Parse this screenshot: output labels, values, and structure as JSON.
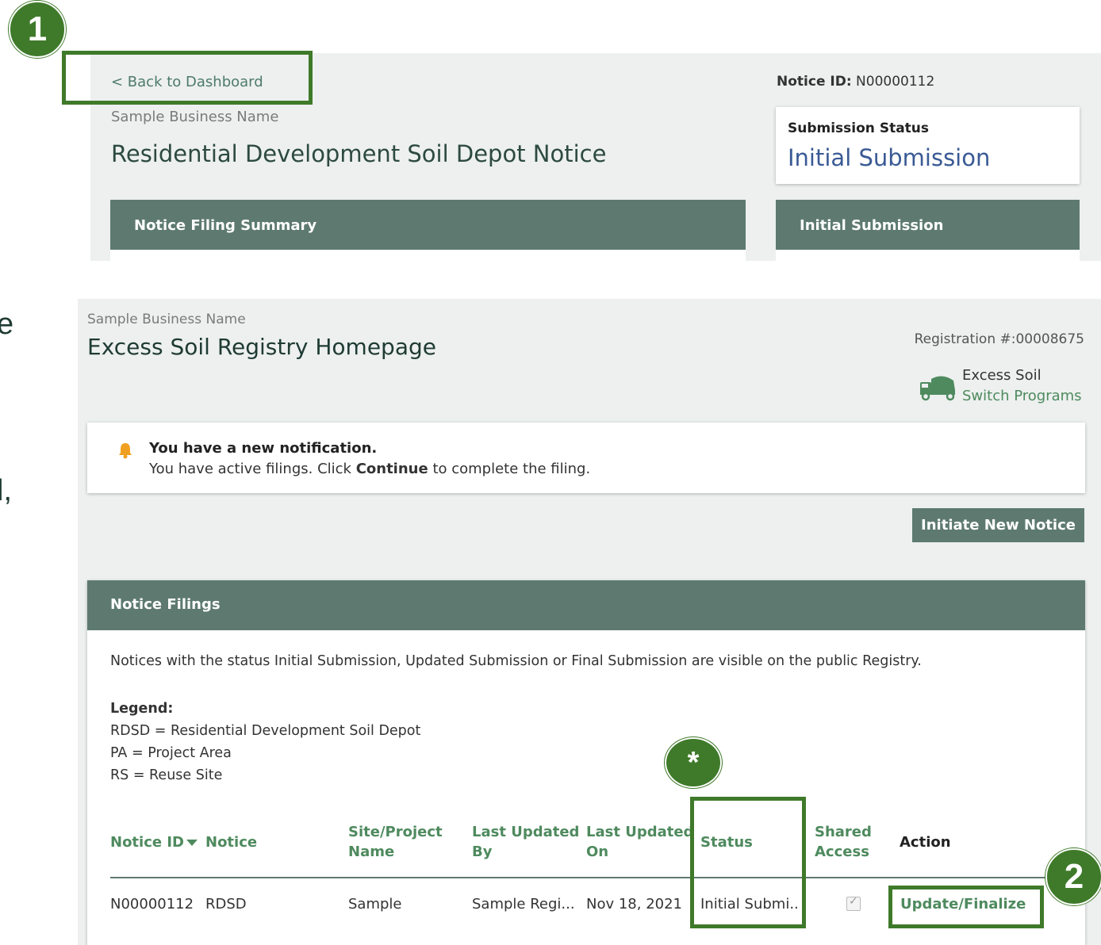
{
  "callouts": {
    "one": "1",
    "two": "2",
    "star": "*"
  },
  "edge_text": {
    "a": "e",
    "b": "l,"
  },
  "notice_page": {
    "back_link": "< Back to Dashboard",
    "business_name": "Sample Business Name",
    "title": "Residential Development Soil Depot Notice",
    "notice_id_label": "Notice ID:",
    "notice_id_value": "N00000112",
    "status_label": "Submission Status",
    "status_value": "Initial Submission",
    "summary_title": "Notice Filing Summary",
    "side_title": "Initial Submission"
  },
  "home_page": {
    "business_name": "Sample Business Name",
    "title": "Excess Soil Registry Homepage",
    "registration": "Registration #:00008675",
    "program_label": "Excess Soil",
    "switch_programs": "Switch Programs",
    "notification_title": "You have a new notification.",
    "notification_pre": "You have active filings. Click",
    "notification_bold": "Continue",
    "notification_post": "to complete the filing.",
    "initiate_button": "Initiate New Notice",
    "filings_title": "Notice Filings",
    "filings_desc": "Notices with the status Initial Submission, Updated Submission or Final Submission are visible on the public Registry.",
    "legend_title": "Legend:",
    "legend_items": [
      "RDSD = Residential Development Soil Depot",
      "PA = Project Area",
      "RS = Reuse Site"
    ],
    "columns": {
      "notice_id": "Notice ID",
      "notice": "Notice",
      "site_1": "Site/Project",
      "site_2": "Name",
      "updated_by_1": "Last Updated",
      "updated_by_2": "By",
      "updated_on_1": "Last Updated",
      "updated_on_2": "On",
      "status": "Status",
      "shared_1": "Shared",
      "shared_2": "Access",
      "action": "Action"
    },
    "row": {
      "notice_id": "N00000112",
      "notice": "RDSD",
      "site": "Sample",
      "updated_by": "Sample Regi...",
      "updated_on": "Nov 18, 2021",
      "status": "Initial Submi..",
      "shared_access": true,
      "action": "Update/Finalize"
    }
  },
  "colors": {
    "accent": "#3f7a2a",
    "header_bar": "#5e7a70",
    "link_green": "#4e8a5e",
    "status_blue": "#3a5a95"
  }
}
